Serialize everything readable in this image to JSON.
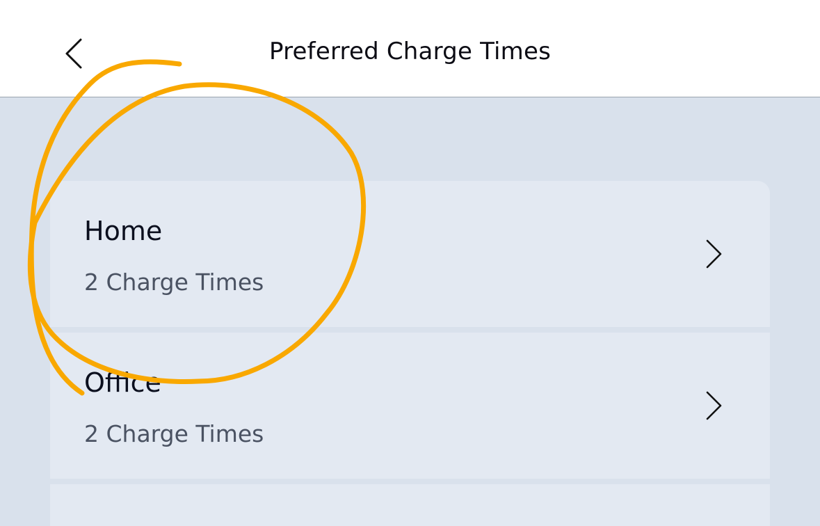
{
  "header": {
    "title": "Preferred Charge Times",
    "back_icon": "chevron-left-icon"
  },
  "locations": [
    {
      "name": "Home",
      "charge_times": "2 Charge Times"
    },
    {
      "name": "Office",
      "charge_times": "2 Charge Times"
    }
  ],
  "colors": {
    "background": "#d9e1ec",
    "card": "#e3e9f2",
    "annotation": "#f9a800",
    "title_text": "#0c0c14",
    "subtext": "#4a5262"
  }
}
